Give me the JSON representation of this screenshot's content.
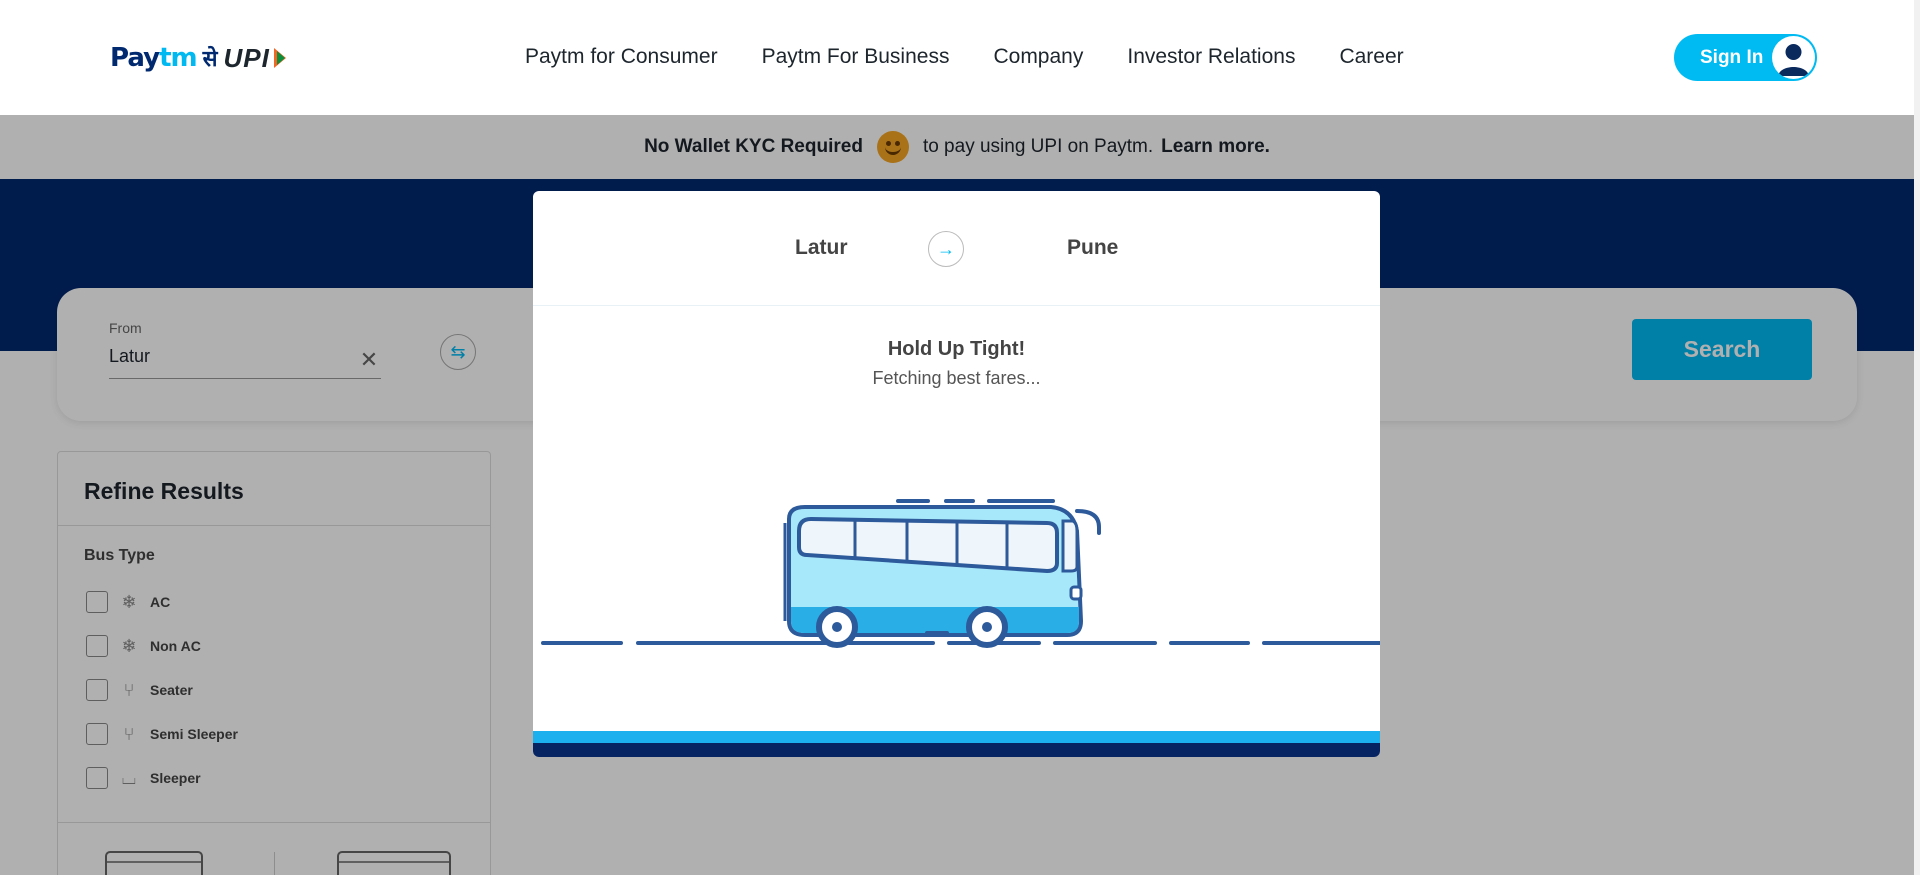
{
  "header": {
    "logo": {
      "paytm_part1": "Pay",
      "paytm_part2": "tm",
      "se": "से",
      "upi": "UPI"
    },
    "nav": [
      {
        "label": "Paytm for Consumer"
      },
      {
        "label": "Paytm For Business"
      },
      {
        "label": "Company"
      },
      {
        "label": "Investor Relations"
      },
      {
        "label": "Career"
      }
    ],
    "signin_label": "Sign In"
  },
  "notice": {
    "bold_text": "No Wallet KYC Required",
    "middle_text": "to pay using UPI on Paytm.",
    "link_text": "Learn more."
  },
  "search": {
    "from_label": "From",
    "from_value": "Latur",
    "clear_glyph": "✕",
    "swap_glyph": "⇆",
    "search_button": "Search"
  },
  "refine": {
    "title": "Refine Results",
    "bus_type_label": "Bus Type",
    "filters": [
      {
        "label": "AC",
        "icon": "❄"
      },
      {
        "label": "Non AC",
        "icon": "❄"
      },
      {
        "label": "Seater",
        "icon": "⑂"
      },
      {
        "label": "Semi Sleeper",
        "icon": "⑂"
      },
      {
        "label": "Sleeper",
        "icon": "⌴"
      }
    ]
  },
  "modal": {
    "from_city": "Latur",
    "arrow_glyph": "→",
    "to_city": "Pune",
    "heading": "Hold Up Tight!",
    "subheading": "Fetching best fares..."
  },
  "colors": {
    "brand_blue": "#00baf2",
    "brand_navy": "#002970",
    "progress_light": "#1cb0ef",
    "progress_dark": "#062461"
  }
}
